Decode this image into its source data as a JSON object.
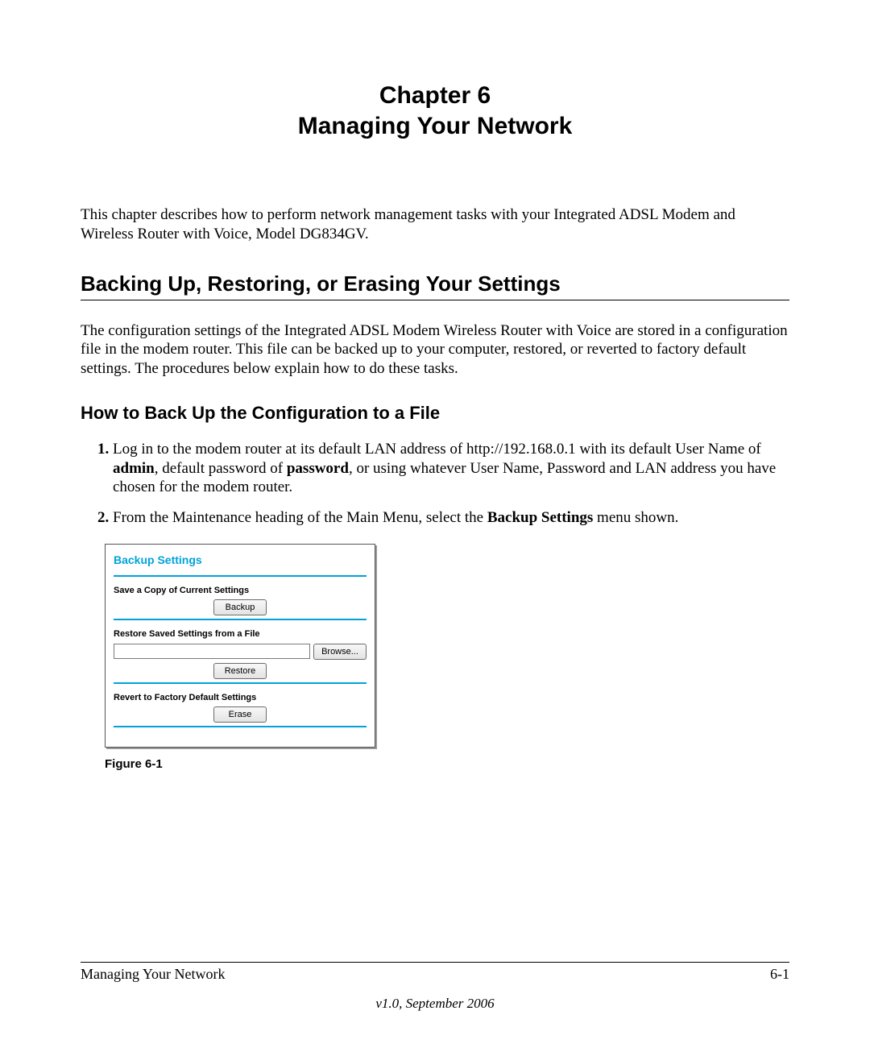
{
  "chapter": {
    "line1": "Chapter 6",
    "line2": "Managing Your Network"
  },
  "intro": "This chapter describes how to perform network management tasks with your Integrated ADSL Modem and Wireless Router with Voice, Model DG834GV.",
  "section1": {
    "heading": "Backing Up, Restoring, or Erasing Your Settings",
    "body": "The configuration settings of the Integrated ADSL Modem Wireless Router with Voice are stored in a configuration file in the modem router. This file can be backed up to your computer, restored, or reverted to factory default settings. The procedures below explain how to do these tasks."
  },
  "sub1": {
    "heading": "How to Back Up the Configuration to a File",
    "step1": {
      "pre": "Log in to the modem router at its default LAN address of http://192.168.0.1 with its default User Name of ",
      "b1": "admin",
      "mid": ", default password of ",
      "b2": "password",
      "post": ", or using whatever User Name, Password and LAN address you have chosen for the modem router."
    },
    "step2": {
      "pre": "From the Maintenance heading of the Main Menu, select the ",
      "b1": "Backup Settings",
      "post": " menu shown."
    }
  },
  "ui": {
    "title": "Backup Settings",
    "save_label": "Save a Copy of Current Settings",
    "backup_btn": "Backup",
    "restore_label": "Restore Saved Settings from a File",
    "browse_btn": "Browse...",
    "restore_btn": "Restore",
    "revert_label": "Revert to Factory Default Settings",
    "erase_btn": "Erase"
  },
  "figure_caption": "Figure 6-1",
  "footer": {
    "left": "Managing Your Network",
    "right": "6-1",
    "version": "v1.0, September 2006"
  }
}
